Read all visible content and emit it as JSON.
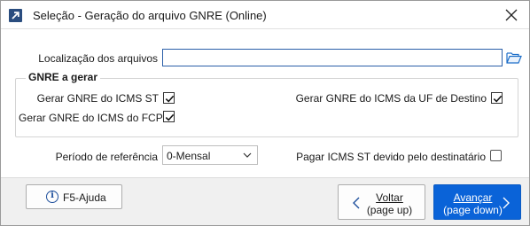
{
  "window": {
    "title": "Seleção - Geração do arquivo GNRE (Online)"
  },
  "files": {
    "location_label": "Localização dos arquivos",
    "location_value": ""
  },
  "gnre_group": {
    "legend": "GNRE a gerar",
    "options": {
      "icms_st": {
        "label": "Gerar GNRE do ICMS ST",
        "checked": true
      },
      "icms_fcp": {
        "label": "Gerar GNRE do ICMS do FCP",
        "checked": true
      },
      "icms_uf_destino": {
        "label": "Gerar GNRE do ICMS da UF de Destino",
        "checked": true
      }
    }
  },
  "period": {
    "label": "Período de referência",
    "selected": "0-Mensal"
  },
  "pay_st": {
    "label": "Pagar ICMS ST devido pelo destinatário",
    "checked": false
  },
  "footer": {
    "help_label": "F5-Ajuda",
    "back_line1": "Voltar",
    "back_line2": "(page up)",
    "next_line1": "Avançar",
    "next_line2": "(page down)"
  },
  "icons": {
    "app": "arrow-up-right-icon",
    "close": "close-icon",
    "folder": "folder-open-icon",
    "help": "info-icon",
    "back": "chevron-left-icon",
    "next": "chevron-right-icon",
    "select": "chevron-down-icon"
  },
  "colors": {
    "accent": "#0a63d8",
    "app_icon_bg": "#2a4d7f",
    "input_border": "#2a5fa8",
    "folder": "#1e6fc9"
  }
}
